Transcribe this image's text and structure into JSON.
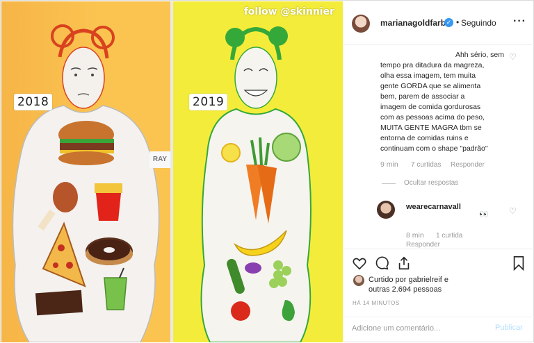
{
  "image": {
    "label_left_year": "2018",
    "label_right_year": "2019",
    "watermark": "follow @skinnier",
    "brand_fragment": "RAY"
  },
  "post": {
    "username": "marianagoldfarb",
    "follow_separator": "•",
    "follow_status": "Seguindo",
    "more_icon": "more-horizontal-icon",
    "verified_icon": "✓"
  },
  "comments": {
    "caption_lines": [
      "Ahh sério, sem",
      "tempo pra ditadura da magreza,",
      "olha essa imagem, tem muita",
      "gente GORDA que se alimenta",
      "bem, parem de associar a",
      "imagem de comida gordurosas",
      "com as pessoas acima do peso,",
      "MUITA GENTE MAGRA tbm se",
      "entorna de comidas ruins e",
      "continuam com o shape \"padrão\""
    ],
    "caption_time": "9 min",
    "caption_likes": "7 curtidas",
    "caption_reply": "Responder",
    "hide_replies": "Ocultar respostas",
    "reply": {
      "username": "wearecarnavall",
      "emoji": "👀",
      "time": "8 min",
      "likes": "1 curtida",
      "reply_label": "Responder"
    }
  },
  "actions": {
    "liked_by_line1": "Curtido por gabrielreif e",
    "liked_by_line2": "outras 2.694 pessoas",
    "post_time": "HÁ 14 MINUTOS",
    "comment_placeholder": "Adicione um comentário...",
    "publish_label": "Publicar"
  },
  "colors": {
    "left_panel": "#fbc451",
    "right_panel": "#f4ec3b",
    "link_blue": "#b2dffc",
    "verified_blue": "#3897f0"
  }
}
